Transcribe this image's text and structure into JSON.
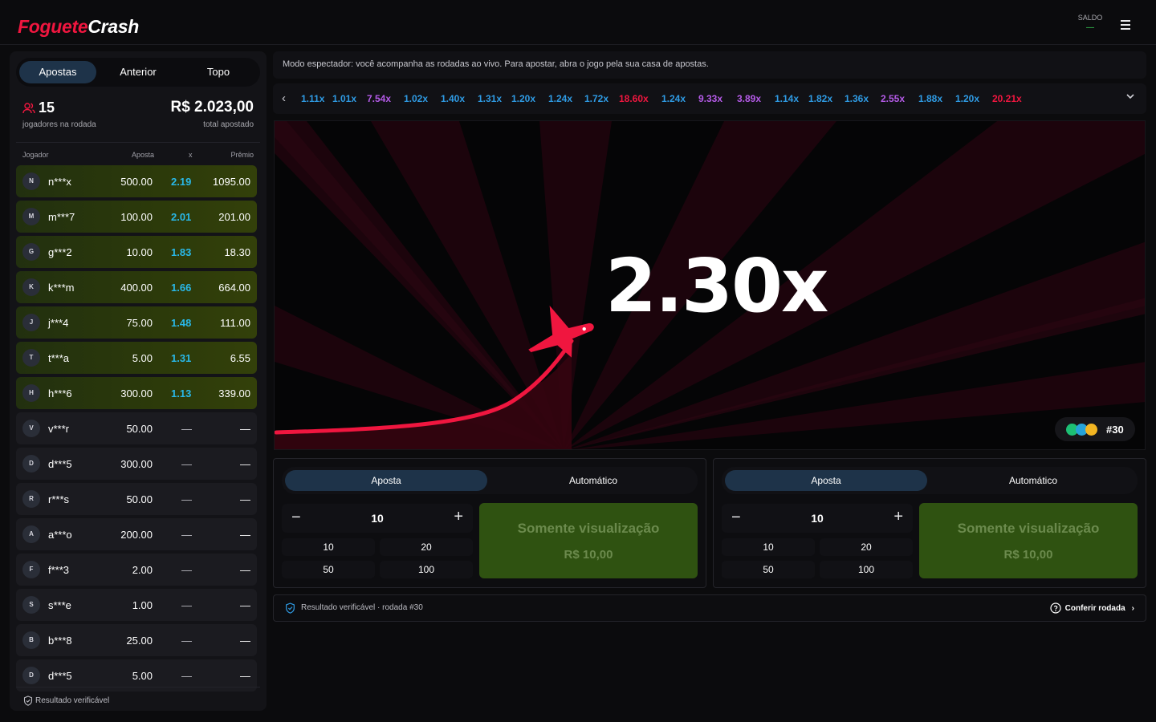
{
  "header": {
    "logo_part1": "Foguete",
    "logo_part2": "Crash",
    "saldo_label": "SALDO",
    "saldo_value": "—"
  },
  "sidebar": {
    "tabs": [
      "Apostas",
      "Anterior",
      "Topo"
    ],
    "players_count": "15",
    "players_label": "jogadores na rodada",
    "total_amount": "R$ 2.023,00",
    "total_label": "total apostado",
    "columns": {
      "player": "Jogador",
      "bet": "Aposta",
      "mult": "x",
      "prize": "Prêmio"
    },
    "players": [
      {
        "initial": "N",
        "name": "n***x",
        "bet": "500.00",
        "mult": "2.19",
        "prize": "1095.00",
        "won": true
      },
      {
        "initial": "M",
        "name": "m***7",
        "bet": "100.00",
        "mult": "2.01",
        "prize": "201.00",
        "won": true
      },
      {
        "initial": "G",
        "name": "g***2",
        "bet": "10.00",
        "mult": "1.83",
        "prize": "18.30",
        "won": true
      },
      {
        "initial": "K",
        "name": "k***m",
        "bet": "400.00",
        "mult": "1.66",
        "prize": "664.00",
        "won": true
      },
      {
        "initial": "J",
        "name": "j***4",
        "bet": "75.00",
        "mult": "1.48",
        "prize": "111.00",
        "won": true
      },
      {
        "initial": "T",
        "name": "t***a",
        "bet": "5.00",
        "mult": "1.31",
        "prize": "6.55",
        "won": true
      },
      {
        "initial": "H",
        "name": "h***6",
        "bet": "300.00",
        "mult": "1.13",
        "prize": "339.00",
        "won": true
      },
      {
        "initial": "V",
        "name": "v***r",
        "bet": "50.00",
        "mult": "—",
        "prize": "—",
        "won": false
      },
      {
        "initial": "D",
        "name": "d***5",
        "bet": "300.00",
        "mult": "—",
        "prize": "—",
        "won": false
      },
      {
        "initial": "R",
        "name": "r***s",
        "bet": "50.00",
        "mult": "—",
        "prize": "—",
        "won": false
      },
      {
        "initial": "A",
        "name": "a***o",
        "bet": "200.00",
        "mult": "—",
        "prize": "—",
        "won": false
      },
      {
        "initial": "F",
        "name": "f***3",
        "bet": "2.00",
        "mult": "—",
        "prize": "—",
        "won": false
      },
      {
        "initial": "S",
        "name": "s***e",
        "bet": "1.00",
        "mult": "—",
        "prize": "—",
        "won": false
      },
      {
        "initial": "B",
        "name": "b***8",
        "bet": "25.00",
        "mult": "—",
        "prize": "—",
        "won": false
      },
      {
        "initial": "D",
        "name": "d***5",
        "bet": "5.00",
        "mult": "—",
        "prize": "—",
        "won": false
      }
    ],
    "footer": "Resultado verificável"
  },
  "spectator_notice": "Modo espectador: você acompanha as rodadas ao vivo. Para apostar, abra o jogo pela sua casa de apostas.",
  "history": [
    {
      "label": "1.11x",
      "color": "#2f9be4"
    },
    {
      "label": "1.01x",
      "color": "#2f9be4"
    },
    {
      "label": "7.54x",
      "color": "#b55be8"
    },
    {
      "label": "1.02x",
      "color": "#2f9be4"
    },
    {
      "label": "1.40x",
      "color": "#2f9be4"
    },
    {
      "label": "1.31x",
      "color": "#2f9be4"
    },
    {
      "label": "1.20x",
      "color": "#2f9be4"
    },
    {
      "label": "1.24x",
      "color": "#2f9be4"
    },
    {
      "label": "1.72x",
      "color": "#2f9be4"
    },
    {
      "label": "18.60x",
      "color": "#f0163f"
    },
    {
      "label": "1.24x",
      "color": "#2f9be4"
    },
    {
      "label": "9.33x",
      "color": "#b55be8"
    },
    {
      "label": "3.89x",
      "color": "#b55be8"
    },
    {
      "label": "1.14x",
      "color": "#2f9be4"
    },
    {
      "label": "1.82x",
      "color": "#2f9be4"
    },
    {
      "label": "1.36x",
      "color": "#2f9be4"
    },
    {
      "label": "2.55x",
      "color": "#b55be8"
    },
    {
      "label": "1.88x",
      "color": "#2f9be4"
    },
    {
      "label": "1.20x",
      "color": "#2f9be4"
    },
    {
      "label": "20.21x",
      "color": "#f0163f"
    }
  ],
  "game": {
    "multiplier": "2.30x",
    "round": "#30"
  },
  "bet_panels": [
    {
      "tabs": [
        "Aposta",
        "Automático"
      ],
      "amount": "10",
      "chips": [
        "10",
        "20",
        "50",
        "100"
      ],
      "button_line1": "Somente visualização",
      "button_line2": "R$ 10,00"
    },
    {
      "tabs": [
        "Aposta",
        "Automático"
      ],
      "amount": "10",
      "chips": [
        "10",
        "20",
        "50",
        "100"
      ],
      "button_line1": "Somente visualização",
      "button_line2": "R$ 10,00"
    }
  ],
  "verify_bar": {
    "text": "Resultado verificável · rodada #30",
    "link": "Conferir rodada"
  },
  "colors": {
    "accent_red": "#f0163f",
    "mult_blue": "#2f9be4",
    "mult_purple": "#b55be8",
    "won_green": "#2c3a0a",
    "cta_green": "#2f5211",
    "tab_active": "#1e3349"
  }
}
